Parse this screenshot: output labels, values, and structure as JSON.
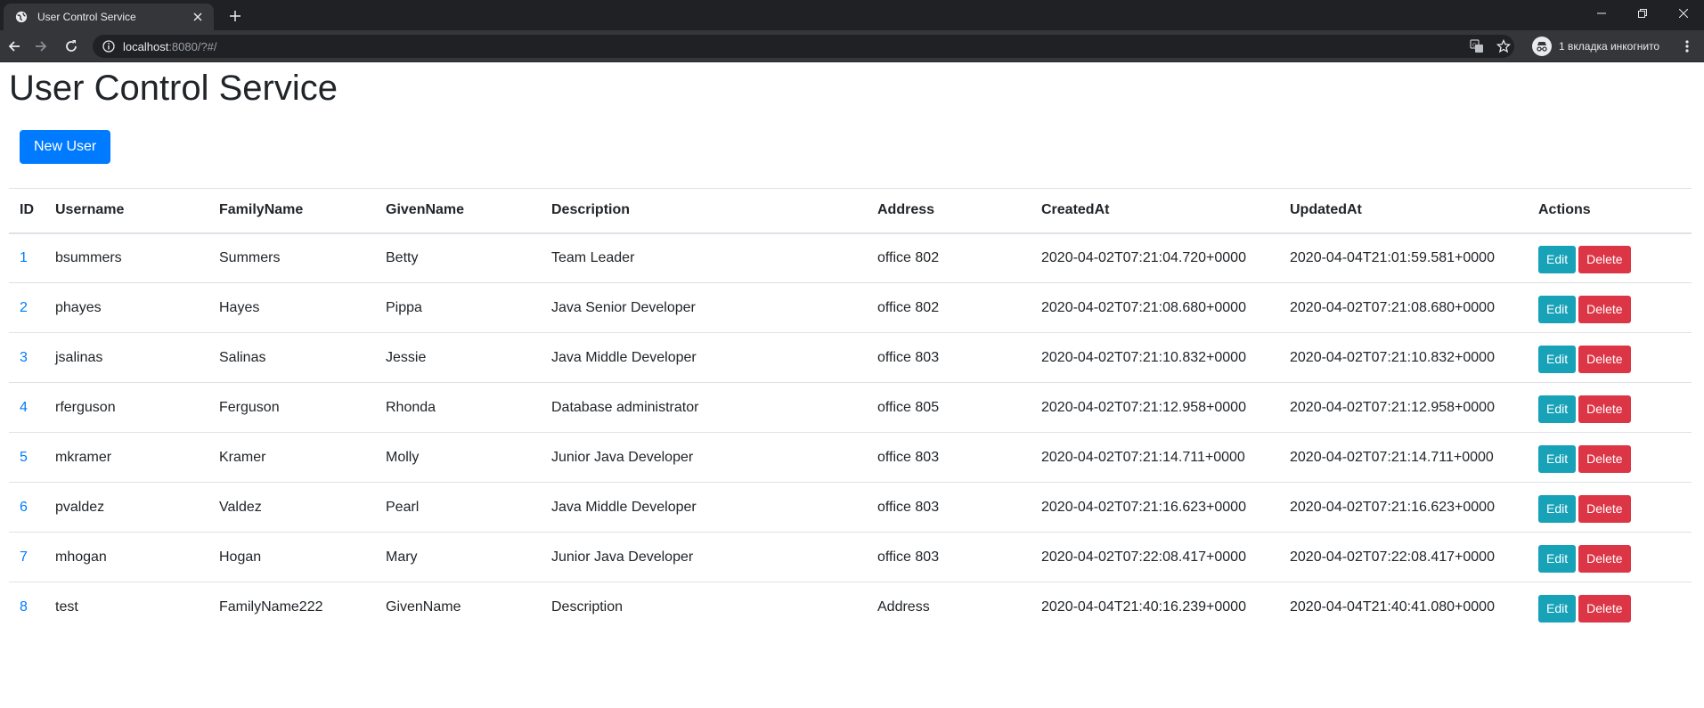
{
  "browser": {
    "tab_title": "User Control Service",
    "url_host": "localhost",
    "url_rest": ":8080/?#/",
    "profile_label": "1 вкладка инкогнито",
    "colors": {
      "chrome_dark": "#202124",
      "chrome_toolbar": "#35363a",
      "text_light": "#e8eaed"
    }
  },
  "page": {
    "title": "User Control Service",
    "new_user_label": "New User",
    "colors": {
      "primary": "#007bff",
      "info": "#17a2b8",
      "danger": "#dc3545",
      "border": "#dee2e6"
    }
  },
  "table": {
    "headers": [
      "ID",
      "Username",
      "FamilyName",
      "GivenName",
      "Description",
      "Address",
      "CreatedAt",
      "UpdatedAt",
      "Actions"
    ],
    "edit_label": "Edit",
    "delete_label": "Delete",
    "rows": [
      {
        "id": "1",
        "username": "bsummers",
        "family": "Summers",
        "given": "Betty",
        "description": "Team Leader",
        "address": "office 802",
        "created": "2020-04-02T07:21:04.720+0000",
        "updated": "2020-04-04T21:01:59.581+0000"
      },
      {
        "id": "2",
        "username": "phayes",
        "family": "Hayes",
        "given": "Pippa",
        "description": "Java Senior Developer",
        "address": "office 802",
        "created": "2020-04-02T07:21:08.680+0000",
        "updated": "2020-04-02T07:21:08.680+0000"
      },
      {
        "id": "3",
        "username": "jsalinas",
        "family": "Salinas",
        "given": "Jessie",
        "description": "Java Middle Developer",
        "address": "office 803",
        "created": "2020-04-02T07:21:10.832+0000",
        "updated": "2020-04-02T07:21:10.832+0000"
      },
      {
        "id": "4",
        "username": "rferguson",
        "family": "Ferguson",
        "given": "Rhonda",
        "description": "Database administrator",
        "address": "office 805",
        "created": "2020-04-02T07:21:12.958+0000",
        "updated": "2020-04-02T07:21:12.958+0000"
      },
      {
        "id": "5",
        "username": "mkramer",
        "family": "Kramer",
        "given": "Molly",
        "description": "Junior Java Developer",
        "address": "office 803",
        "created": "2020-04-02T07:21:14.711+0000",
        "updated": "2020-04-02T07:21:14.711+0000"
      },
      {
        "id": "6",
        "username": "pvaldez",
        "family": "Valdez",
        "given": "Pearl",
        "description": "Java Middle Developer",
        "address": "office 803",
        "created": "2020-04-02T07:21:16.623+0000",
        "updated": "2020-04-02T07:21:16.623+0000"
      },
      {
        "id": "7",
        "username": "mhogan",
        "family": "Hogan",
        "given": "Mary",
        "description": "Junior Java Developer",
        "address": "office 803",
        "created": "2020-04-02T07:22:08.417+0000",
        "updated": "2020-04-02T07:22:08.417+0000"
      },
      {
        "id": "8",
        "username": "test",
        "family": "FamilyName222",
        "given": "GivenName",
        "description": "Description",
        "address": "Address",
        "created": "2020-04-04T21:40:16.239+0000",
        "updated": "2020-04-04T21:40:41.080+0000"
      }
    ]
  },
  "icons": [
    "globe-icon",
    "close-icon",
    "plus-icon",
    "minimize-icon",
    "restore-icon",
    "window-close-icon",
    "back-icon",
    "forward-icon",
    "reload-icon",
    "info-icon",
    "translate-icon",
    "star-icon",
    "incognito-icon",
    "menu-icon"
  ]
}
